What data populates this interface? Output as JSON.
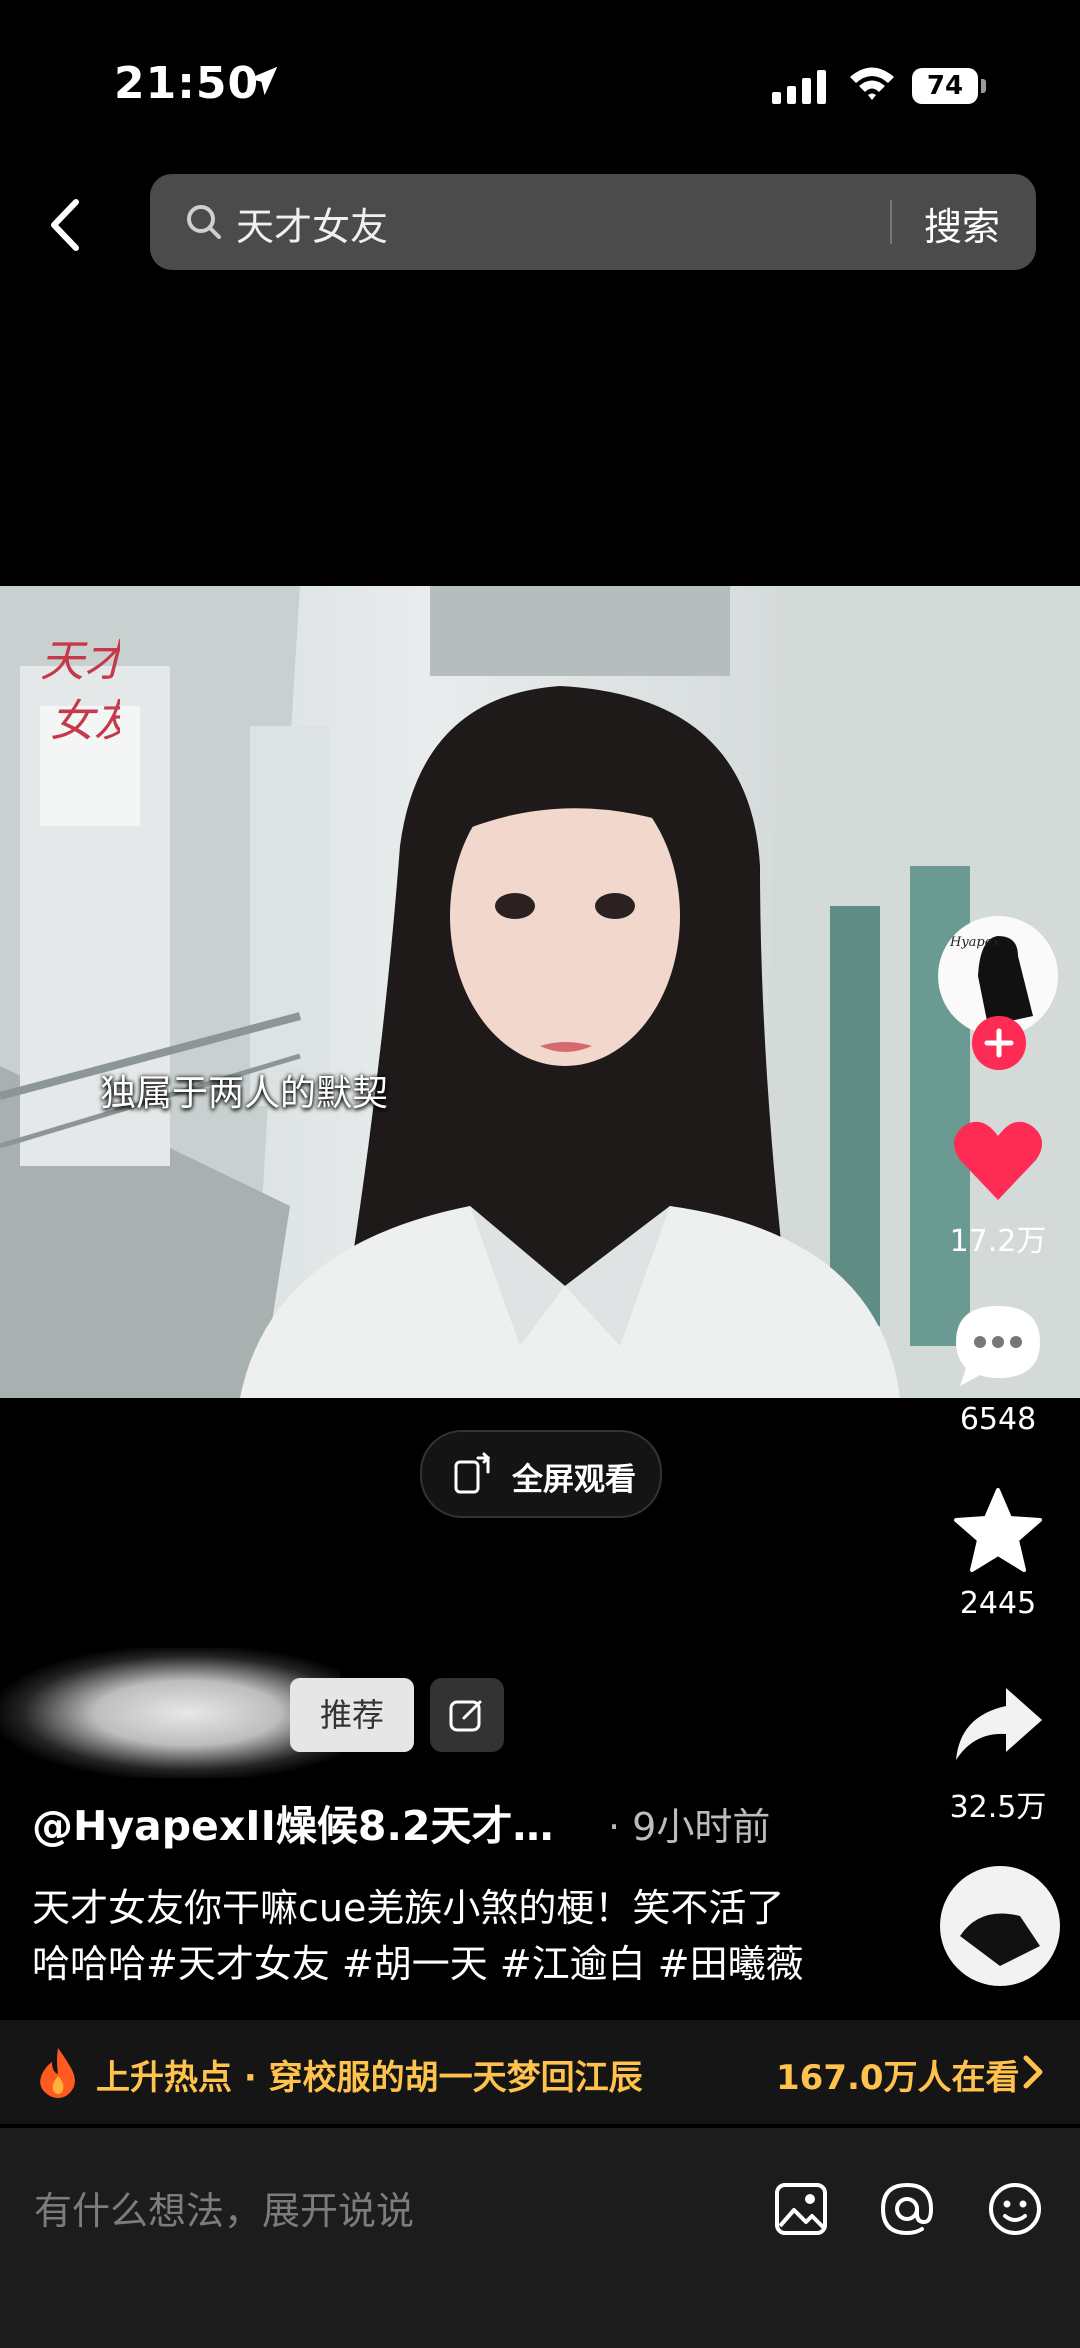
{
  "status": {
    "time": "21:50",
    "battery": "74"
  },
  "search": {
    "query": "天才女友",
    "button": "搜索"
  },
  "video": {
    "watermark": "天才女友",
    "caption": "独属于两人的默契",
    "fullscreen_label": "全屏观看"
  },
  "rail": {
    "avatar_text": "Hyapex",
    "likes": "17.2万",
    "comments": "6548",
    "favorites": "2445",
    "shares": "32.5万"
  },
  "post": {
    "tag_chip": "推荐",
    "author": "@HyapexII燥候8.2天才…",
    "time": "· 9小时前",
    "description_line1": "天才女友你干嘛cue羌族小煞的梗！笑不活了",
    "description_line2": "哈哈哈#天才女友 #胡一天 #江逾白 #田曦薇"
  },
  "hot": {
    "label": "上升热点 · 穿校服的胡一天梦回江辰",
    "count": "167.0万人在看"
  },
  "comment": {
    "placeholder": "有什么想法，展开说说"
  },
  "colors": {
    "accent_like": "#fe2c55",
    "hot_text": "#ffc34d",
    "search_bg": "#4b4b4b"
  }
}
